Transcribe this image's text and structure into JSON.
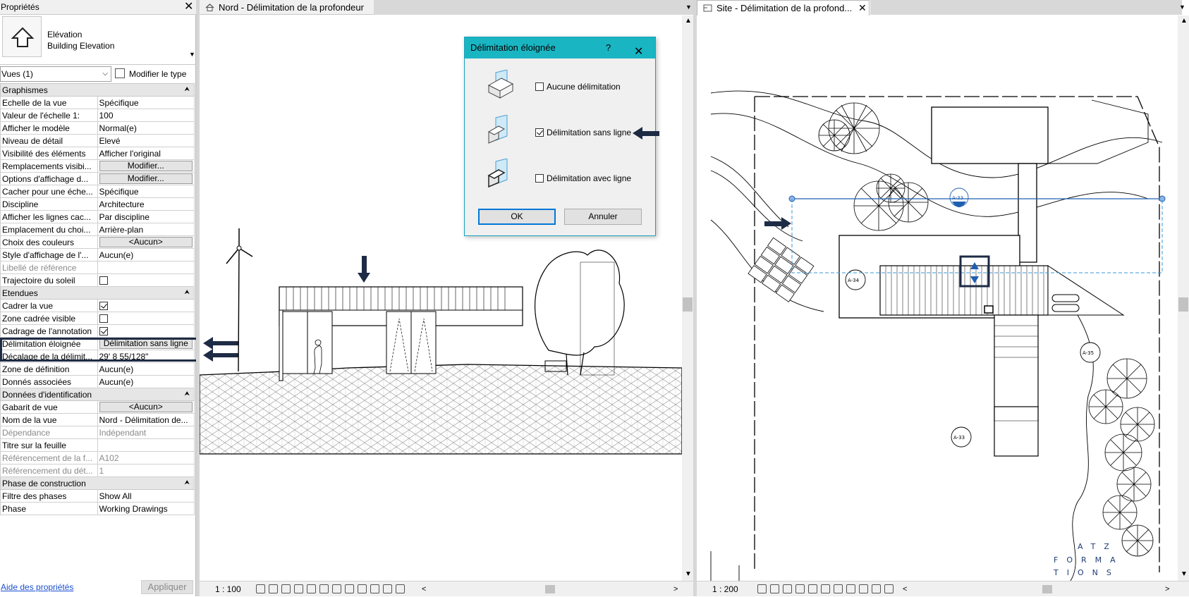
{
  "properties": {
    "title": "Propriétés",
    "type_line1": "Elévation",
    "type_line2": "Building Elevation",
    "views_selector": "Vues (1)",
    "edit_type": "Modifier le type",
    "help_link": "Aide des propriétés",
    "apply": "Appliquer",
    "groups": {
      "graphics": "Graphismes",
      "extents": "Etendues",
      "identity": "Données d'identification",
      "phasing": "Phase de construction"
    },
    "rows": {
      "r1": {
        "label": "Echelle de la vue",
        "value": "Spécifique"
      },
      "r2": {
        "label": "Valeur de l'échelle    1:",
        "value": "100"
      },
      "r3": {
        "label": "Afficher le modèle",
        "value": "Normal(e)"
      },
      "r4": {
        "label": "Niveau de détail",
        "value": "Elevé"
      },
      "r5": {
        "label": "Visibilité des éléments",
        "value": "Afficher l'original"
      },
      "r6": {
        "label": "Remplacements visibi...",
        "value": "Modifier..."
      },
      "r7": {
        "label": "Options d'affichage d...",
        "value": "Modifier..."
      },
      "r8": {
        "label": "Cacher pour une éche...",
        "value": "Spécifique"
      },
      "r9": {
        "label": "Discipline",
        "value": "Architecture"
      },
      "r10": {
        "label": "Afficher les lignes cac...",
        "value": "Par discipline"
      },
      "r11": {
        "label": "Emplacement du choi...",
        "value": "Arrière-plan"
      },
      "r12": {
        "label": "Choix des couleurs",
        "value": "<Aucun>"
      },
      "r13": {
        "label": "Style d'affichage de l'...",
        "value": "Aucun(e)"
      },
      "r14": {
        "label": "Libellé de référence",
        "value": ""
      },
      "r15": {
        "label": "Trajectoire du soleil",
        "value": ""
      },
      "e1": {
        "label": "Cadrer la vue",
        "value": ""
      },
      "e2": {
        "label": "Zone cadrée visible",
        "value": ""
      },
      "e3": {
        "label": "Cadrage de l'annotation",
        "value": ""
      },
      "e4": {
        "label": "Délimitation éloignée",
        "value": "Délimitation sans ligne"
      },
      "e5": {
        "label": "Décalage de la délimit...",
        "value": "29'  8 55/128\""
      },
      "e6": {
        "label": "Zone de définition",
        "value": "Aucun(e)"
      },
      "e7": {
        "label": "Donnés associées",
        "value": "Aucun(e)"
      },
      "i1": {
        "label": "Gabarit de vue",
        "value": "<Aucun>"
      },
      "i2": {
        "label": "Nom de la vue",
        "value": "Nord - Délimitation de..."
      },
      "i3": {
        "label": "Dépendance",
        "value": "Indépendant"
      },
      "i4": {
        "label": "Titre sur la feuille",
        "value": ""
      },
      "i5": {
        "label": "Référencement de la f...",
        "value": "A102"
      },
      "i6": {
        "label": "Référencement du dét...",
        "value": "1"
      },
      "p1": {
        "label": "Filtre des phases",
        "value": "Show All"
      },
      "p2": {
        "label": "Phase",
        "value": "Working Drawings"
      }
    },
    "checks": {
      "sun_path": false,
      "crop_view": true,
      "crop_visible": false,
      "annotation_crop": true
    }
  },
  "views": {
    "left": {
      "tab": "Nord - Délimitation de la profondeur",
      "scale": "1 : 100"
    },
    "right": {
      "tab": "Site - Délimitation de la profond...",
      "scale": "1 : 200"
    }
  },
  "dialog": {
    "title": "Délimitation éloignée",
    "help": "?",
    "options": [
      {
        "label": "Aucune délimitation",
        "checked": false
      },
      {
        "label": "Délimitation sans ligne",
        "checked": true
      },
      {
        "label": "Délimitation avec ligne",
        "checked": false
      }
    ],
    "ok": "OK",
    "cancel": "Annuler"
  },
  "plan_tags": {
    "t1": "A-33",
    "t2": "A-34",
    "t3": "A-35",
    "t4": "A-33"
  },
  "watermark": {
    "line1": "ATZ",
    "line2": "FORMA",
    "line3": "TIONS"
  },
  "colors": {
    "accent": "#1ab5c2",
    "arrow": "#1e2b45",
    "link": "#1a4fd0",
    "selection": "#1f5fb0"
  },
  "icons": [
    "close-icon",
    "elevation-type-icon",
    "edit-type-icon",
    "collapse-icon",
    "checkbox-icon",
    "house-icon",
    "view-control-icons"
  ]
}
